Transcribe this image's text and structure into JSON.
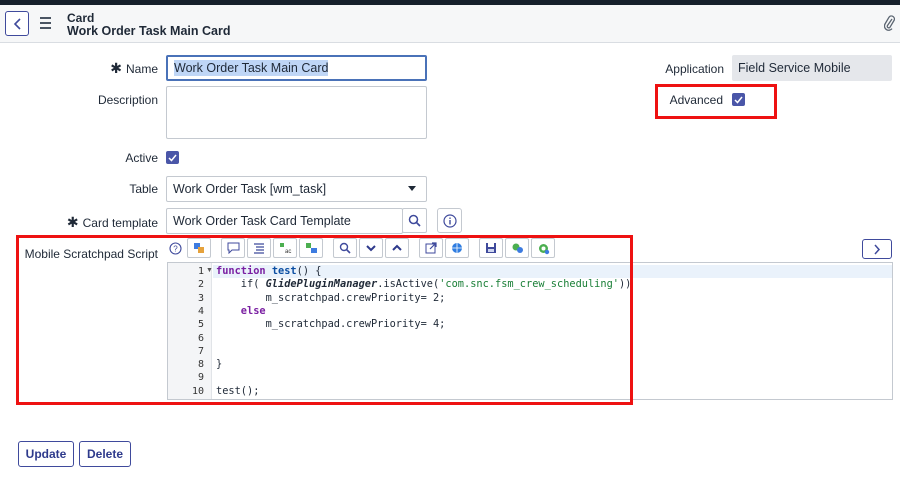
{
  "header": {
    "subtitle": "Card",
    "title": "Work Order Task Main Card"
  },
  "form": {
    "name": {
      "label": "Name",
      "value": "Work Order Task Main Card"
    },
    "description": {
      "label": "Description",
      "value": ""
    },
    "active": {
      "label": "Active",
      "checked": true
    },
    "table": {
      "label": "Table",
      "value": "Work Order Task [wm_task]"
    },
    "card_template": {
      "label": "Card template",
      "value": "Work Order Task Card Template"
    },
    "application": {
      "label": "Application",
      "value": "Field Service Mobile"
    },
    "advanced": {
      "label": "Advanced",
      "checked": true
    },
    "script": {
      "label": "Mobile Scratchpad Script",
      "line_numbers": [
        "1",
        "2",
        "3",
        "4",
        "5",
        "6",
        "7",
        "8",
        "9",
        "10"
      ],
      "lines": [
        {
          "parts": [
            {
              "t": "function",
              "c": "kw"
            },
            {
              "t": " "
            },
            {
              "t": "test",
              "c": "fn"
            },
            {
              "t": "() {"
            }
          ]
        },
        {
          "parts": [
            {
              "t": "    if( "
            },
            {
              "t": "GlidePluginManager",
              "c": "cls"
            },
            {
              "t": ".isActive("
            },
            {
              "t": "'com.snc.fsm_crew_scheduling'",
              "c": "str"
            },
            {
              "t": "))"
            }
          ]
        },
        {
          "parts": [
            {
              "t": "        m_scratchpad.crewPriority= 2;"
            }
          ]
        },
        {
          "parts": [
            {
              "t": "    else",
              "c": "kw"
            }
          ]
        },
        {
          "parts": [
            {
              "t": "        m_scratchpad.crewPriority= 4;"
            }
          ]
        },
        {
          "parts": [
            {
              "t": ""
            }
          ]
        },
        {
          "parts": [
            {
              "t": ""
            }
          ]
        },
        {
          "parts": [
            {
              "t": "}"
            }
          ]
        },
        {
          "parts": [
            {
              "t": ""
            }
          ]
        },
        {
          "parts": [
            {
              "t": "test();"
            }
          ]
        }
      ]
    }
  },
  "footer": {
    "update_label": "Update",
    "delete_label": "Delete"
  },
  "colors": {
    "accent": "#4a56a8",
    "highlight_box": "#e11111"
  }
}
